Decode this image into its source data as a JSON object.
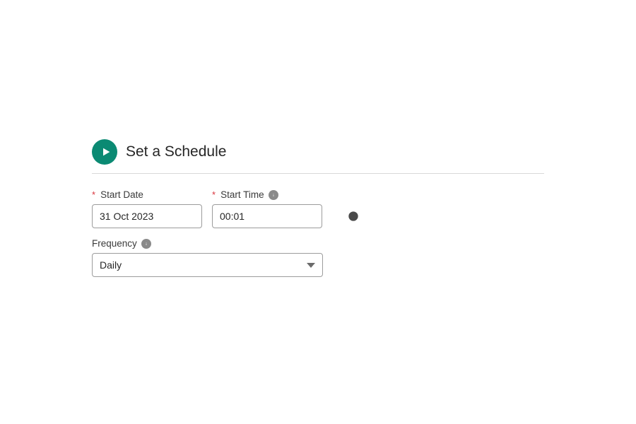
{
  "section": {
    "title": "Set a Schedule"
  },
  "fields": {
    "start_date": {
      "label": "Start Date",
      "required_marker": "*",
      "value": "31 Oct 2023"
    },
    "start_time": {
      "label": "Start Time",
      "required_marker": "*",
      "value": "00:01"
    },
    "frequency": {
      "label": "Frequency",
      "value": "Daily"
    }
  }
}
